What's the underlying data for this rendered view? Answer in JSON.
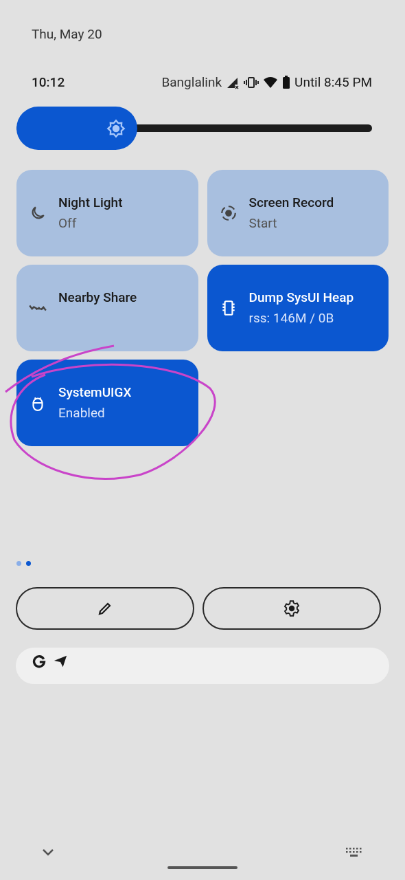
{
  "date": "Thu, May 20",
  "status_bar": {
    "time": "10:12",
    "carrier": "Banglalink",
    "battery": "Until 8:45 PM"
  },
  "brightness": {
    "level": 0.34
  },
  "tiles": [
    {
      "label": "Night Light",
      "secondary": "Off",
      "on": false
    },
    {
      "label": "Screen Record",
      "secondary": "Start",
      "on": false
    },
    {
      "label": "Nearby Share",
      "on": false
    },
    {
      "label": "Dump SysUI Heap",
      "secondary": "rss: 146M / 0B",
      "on": true
    },
    {
      "label": "SystemUIGX",
      "secondary": "Enabled",
      "on": true
    }
  ],
  "pages": [
    {
      "selected": false
    },
    {
      "selected": true
    }
  ]
}
